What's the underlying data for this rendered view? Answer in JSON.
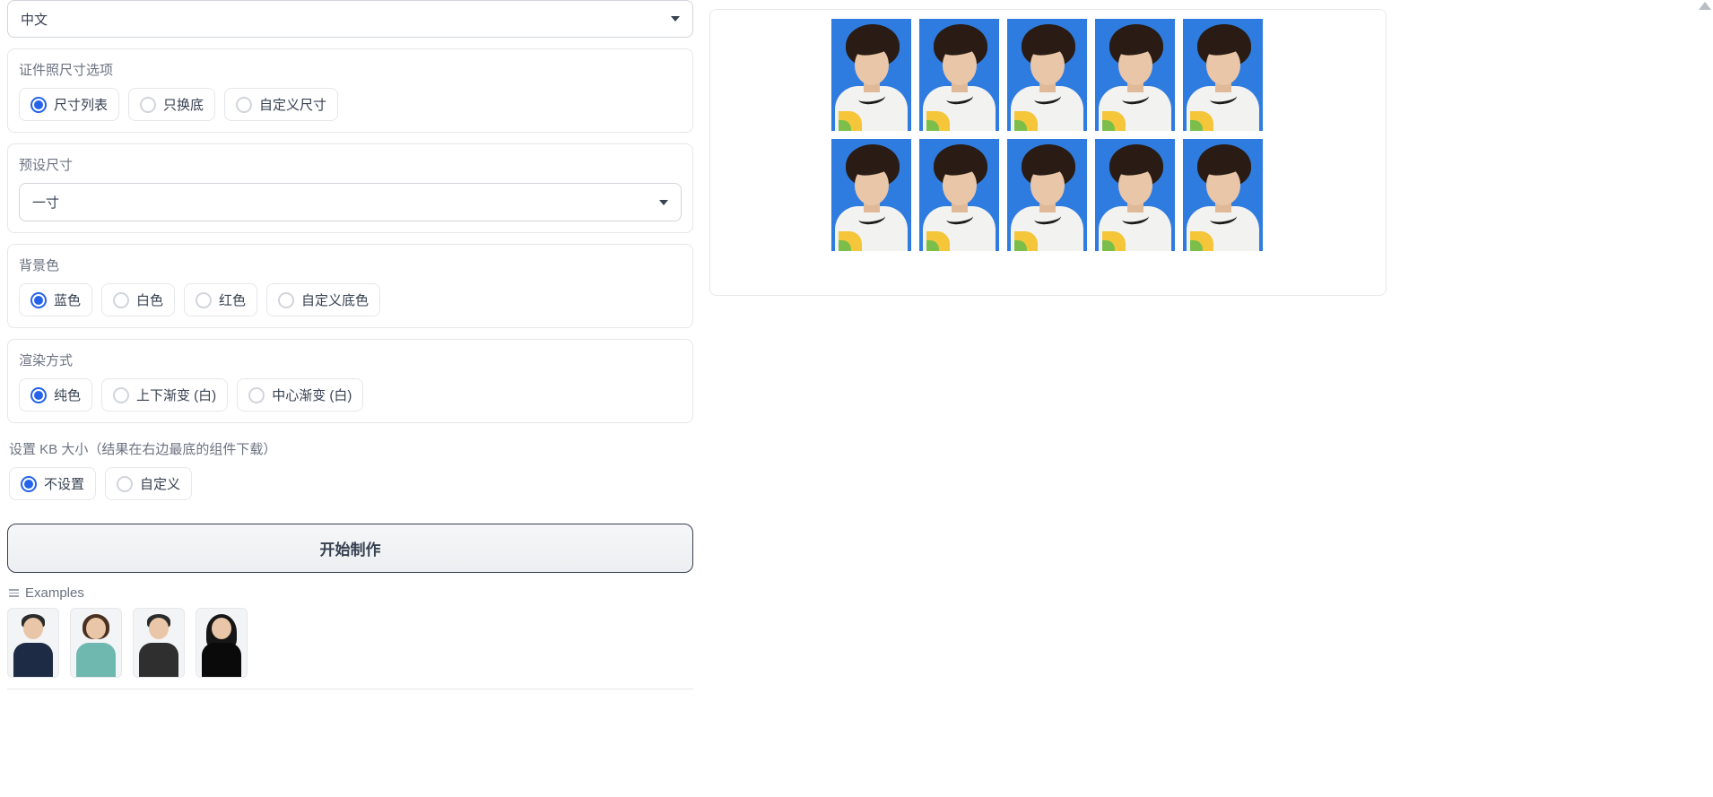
{
  "language": {
    "value": "中文"
  },
  "sizeOption": {
    "label": "证件照尺寸选项",
    "items": [
      "尺寸列表",
      "只换底",
      "自定义尺寸"
    ],
    "selected": 0
  },
  "preset": {
    "label": "预设尺寸",
    "value": "一寸"
  },
  "bgColor": {
    "label": "背景色",
    "items": [
      "蓝色",
      "白色",
      "红色",
      "自定义底色"
    ],
    "selected": 0
  },
  "renderMode": {
    "label": "渲染方式",
    "items": [
      "纯色",
      "上下渐变 (白)",
      "中心渐变 (白)"
    ],
    "selected": 0
  },
  "kbSize": {
    "label": "设置 KB 大小（结果在右边最底的组件下载）",
    "items": [
      "不设置",
      "自定义"
    ],
    "selected": 0
  },
  "startButton": "开始制作",
  "examples": {
    "label": "Examples",
    "count": 4
  },
  "output": {
    "rows": 2,
    "cols": 5,
    "bg": "#2f7ce0"
  }
}
